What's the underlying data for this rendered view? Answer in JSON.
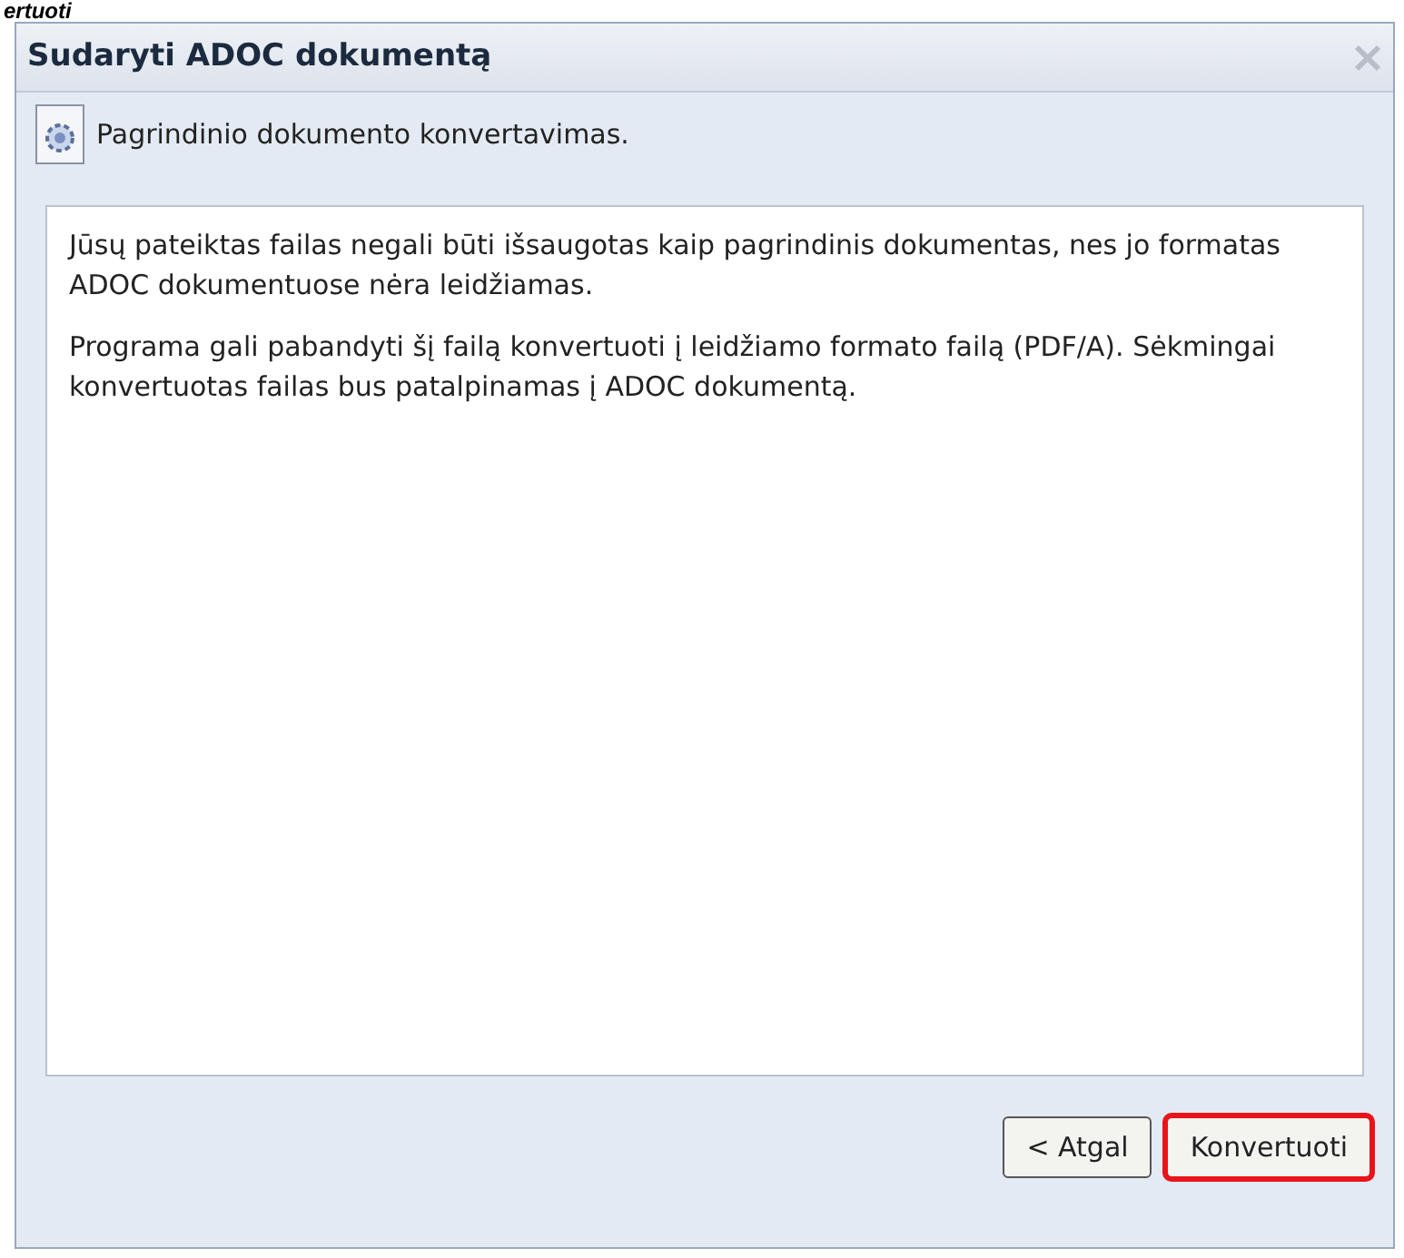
{
  "caption_fragment": "ertuoti",
  "window": {
    "title": "Sudaryti ADOC dokumentą"
  },
  "header": {
    "text": "Pagrindinio dokumento konvertavimas."
  },
  "message": {
    "paragraphs": [
      "Jūsų pateiktas failas negali būti išsaugotas kaip pagrindinis dokumentas, nes jo formatas ADOC dokumentuose nėra leidžiamas.",
      "Programa gali pabandyti šį failą konvertuoti į leidžiamo formato failą (PDF/A). Sėkmingai konvertuotas failas bus patalpinamas į ADOC dokumentą."
    ]
  },
  "buttons": [
    {
      "label": "< Atgal",
      "highlighted": false
    },
    {
      "label": "Konvertuoti",
      "highlighted": true
    }
  ]
}
